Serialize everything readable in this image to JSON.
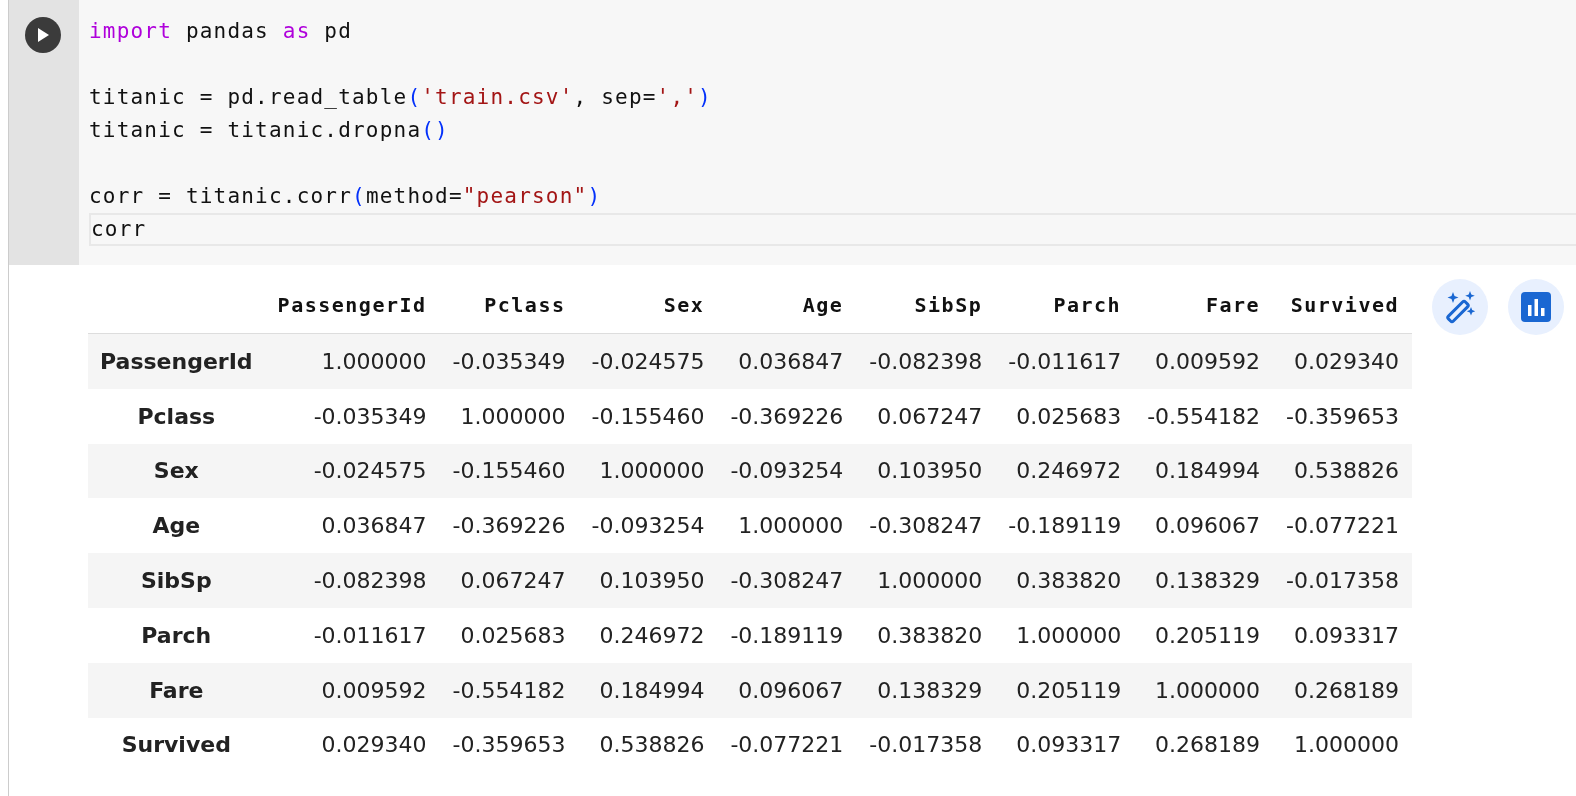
{
  "cell": {
    "code_lines": [
      {
        "kind": "code",
        "tokens": [
          {
            "kind": "keyword",
            "text": "import"
          },
          {
            "kind": "plain",
            "text": " pandas "
          },
          {
            "kind": "keyword",
            "text": "as"
          },
          {
            "kind": "plain",
            "text": " pd"
          }
        ]
      },
      {
        "kind": "blank"
      },
      {
        "kind": "code",
        "tokens": [
          {
            "kind": "plain",
            "text": "titanic = pd.read_table"
          },
          {
            "kind": "paren",
            "text": "("
          },
          {
            "kind": "string",
            "text": "'train.csv'"
          },
          {
            "kind": "plain",
            "text": ", sep="
          },
          {
            "kind": "string",
            "text": "','"
          },
          {
            "kind": "paren",
            "text": ")"
          }
        ]
      },
      {
        "kind": "code",
        "tokens": [
          {
            "kind": "plain",
            "text": "titanic = titanic.dropna"
          },
          {
            "kind": "paren",
            "text": "()"
          }
        ]
      },
      {
        "kind": "blank"
      },
      {
        "kind": "code",
        "tokens": [
          {
            "kind": "plain",
            "text": "corr = titanic.corr"
          },
          {
            "kind": "paren",
            "text": "("
          },
          {
            "kind": "plain",
            "text": "method="
          },
          {
            "kind": "string",
            "text": "\"pearson\""
          },
          {
            "kind": "paren",
            "text": ")"
          }
        ]
      },
      {
        "kind": "current",
        "tokens": [
          {
            "kind": "plain",
            "text": "corr"
          }
        ]
      }
    ]
  },
  "output": {
    "table": {
      "columns": [
        "PassengerId",
        "Pclass",
        "Sex",
        "Age",
        "SibSp",
        "Parch",
        "Fare",
        "Survived"
      ],
      "rows": [
        {
          "index": "PassengerId",
          "cells": [
            "1.000000",
            "-0.035349",
            "-0.024575",
            "0.036847",
            "-0.082398",
            "-0.011617",
            "0.009592",
            "0.029340"
          ]
        },
        {
          "index": "Pclass",
          "cells": [
            "-0.035349",
            "1.000000",
            "-0.155460",
            "-0.369226",
            "0.067247",
            "0.025683",
            "-0.554182",
            "-0.359653"
          ]
        },
        {
          "index": "Sex",
          "cells": [
            "-0.024575",
            "-0.155460",
            "1.000000",
            "-0.093254",
            "0.103950",
            "0.246972",
            "0.184994",
            "0.538826"
          ]
        },
        {
          "index": "Age",
          "cells": [
            "0.036847",
            "-0.369226",
            "-0.093254",
            "1.000000",
            "-0.308247",
            "-0.189119",
            "0.096067",
            "-0.077221"
          ]
        },
        {
          "index": "SibSp",
          "cells": [
            "-0.082398",
            "0.067247",
            "0.103950",
            "-0.308247",
            "1.000000",
            "0.383820",
            "0.138329",
            "-0.017358"
          ]
        },
        {
          "index": "Parch",
          "cells": [
            "-0.011617",
            "0.025683",
            "0.246972",
            "-0.189119",
            "0.383820",
            "1.000000",
            "0.205119",
            "0.093317"
          ]
        },
        {
          "index": "Fare",
          "cells": [
            "0.009592",
            "-0.554182",
            "0.184994",
            "0.096067",
            "0.138329",
            "0.205119",
            "1.000000",
            "0.268189"
          ]
        },
        {
          "index": "Survived",
          "cells": [
            "0.029340",
            "-0.359653",
            "0.538826",
            "-0.077221",
            "-0.017358",
            "0.093317",
            "0.268189",
            "1.000000"
          ]
        }
      ]
    }
  }
}
